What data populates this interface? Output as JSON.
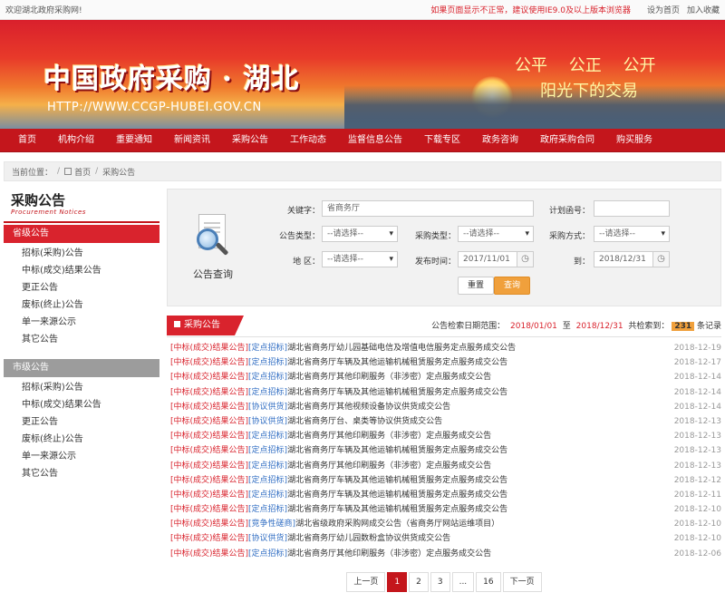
{
  "topbar": {
    "welcome": "欢迎湖北政府采购网!",
    "notice": "如果页面显示不正常，建议使用IE9.0及以上版本浏览器",
    "set_home": "设为首页",
    "bookmark": "加入收藏"
  },
  "banner": {
    "title": "中国政府采购 · 湖北",
    "url": "HTTP://WWW.CCGP-HUBEI.GOV.CN",
    "slogan_line1": "公平 公正 公开",
    "slogan_line2": "阳光下的交易"
  },
  "nav": [
    "首页",
    "机构介绍",
    "重要通知",
    "新闻资讯",
    "采购公告",
    "工作动态",
    "监督信息公告",
    "下载专区",
    "政务咨询",
    "政府采购合同",
    "购买服务"
  ],
  "breadcrumb": {
    "label": "当前位置：",
    "home": "首页",
    "sep": "/",
    "current": "采购公告"
  },
  "sidebar": {
    "title_cn": "采购公告",
    "title_en": "Procurement Notices",
    "groups": [
      {
        "title": "省级公告",
        "items": [
          "招标(采购)公告",
          "中标(成交)结果公告",
          "更正公告",
          "废标(终止)公告",
          "单一来源公示",
          "其它公告"
        ]
      },
      {
        "title": "市级公告",
        "items": [
          "招标(采购)公告",
          "中标(成交)结果公告",
          "更正公告",
          "废标(终止)公告",
          "单一来源公示",
          "其它公告"
        ]
      }
    ]
  },
  "search": {
    "caption": "公告查询",
    "keyword_label": "关键字：",
    "keyword_value": "省商务厅",
    "plan_no_label": "计划函号：",
    "plan_no_value": "",
    "notice_type_label": "公告类型：",
    "notice_type_value": "--请选择--",
    "purchase_type_label": "采购类型：",
    "purchase_type_value": "--请选择--",
    "purchase_method_label": "采购方式：",
    "purchase_method_value": "--请选择--",
    "area_label": "地 区：",
    "area_value": "--请选择--",
    "publish_label": "发布时间：",
    "date_from": "2017/11/01",
    "to_label": "到：",
    "date_to": "2018/12/31",
    "reset": "重置",
    "query": "查询"
  },
  "list_head": {
    "tab": "采购公告",
    "range_label": "公告检索日期范围：",
    "range_from": "2018/01/01",
    "range_to_word": "至",
    "range_to": "2018/12/31",
    "found_label": "共检索到：",
    "count": "231",
    "count_unit": "条记录"
  },
  "notices": [
    {
      "k1": "[中标(成交)结果公告]",
      "k2": "[定点招标]",
      "title": "湖北省商务厅幼儿园基础电信及增值电信服务定点服务成交公告",
      "date": "2018-12-19"
    },
    {
      "k1": "[中标(成交)结果公告]",
      "k2": "[定点招标]",
      "title": "湖北省商务厅车辆及其他运输机械租赁服务定点服务成交公告",
      "date": "2018-12-17"
    },
    {
      "k1": "[中标(成交)结果公告]",
      "k2": "[定点招标]",
      "title": "湖北省商务厅其他印刷服务（非涉密）定点服务成交公告",
      "date": "2018-12-14"
    },
    {
      "k1": "[中标(成交)结果公告]",
      "k2": "[定点招标]",
      "title": "湖北省商务厅车辆及其他运输机械租赁服务定点服务成交公告",
      "date": "2018-12-14"
    },
    {
      "k1": "[中标(成交)结果公告]",
      "k2": "[协议供货]",
      "title": "湖北省商务厅其他视频设备协议供货成交公告",
      "date": "2018-12-14"
    },
    {
      "k1": "[中标(成交)结果公告]",
      "k2": "[协议供货]",
      "title": "湖北省商务厅台、桌类等协议供货成交公告",
      "date": "2018-12-13"
    },
    {
      "k1": "[中标(成交)结果公告]",
      "k2": "[定点招标]",
      "title": "湖北省商务厅其他印刷服务（非涉密）定点服务成交公告",
      "date": "2018-12-13"
    },
    {
      "k1": "[中标(成交)结果公告]",
      "k2": "[定点招标]",
      "title": "湖北省商务厅车辆及其他运输机械租赁服务定点服务成交公告",
      "date": "2018-12-13"
    },
    {
      "k1": "[中标(成交)结果公告]",
      "k2": "[定点招标]",
      "title": "湖北省商务厅其他印刷服务（非涉密）定点服务成交公告",
      "date": "2018-12-13"
    },
    {
      "k1": "[中标(成交)结果公告]",
      "k2": "[定点招标]",
      "title": "湖北省商务厅车辆及其他运输机械租赁服务定点服务成交公告",
      "date": "2018-12-12"
    },
    {
      "k1": "[中标(成交)结果公告]",
      "k2": "[定点招标]",
      "title": "湖北省商务厅车辆及其他运输机械租赁服务定点服务成交公告",
      "date": "2018-12-11"
    },
    {
      "k1": "[中标(成交)结果公告]",
      "k2": "[定点招标]",
      "title": "湖北省商务厅车辆及其他运输机械租赁服务定点服务成交公告",
      "date": "2018-12-10"
    },
    {
      "k1": "[中标(成交)结果公告]",
      "k2": "[竞争性磋商]",
      "title": "湖北省级政府采购网成交公告（省商务厅网站运维项目）",
      "date": "2018-12-10"
    },
    {
      "k1": "[中标(成交)结果公告]",
      "k2": "[协议供货]",
      "title": "湖北省商务厅幼儿园数粉盒协议供货成交公告",
      "date": "2018-12-10"
    },
    {
      "k1": "[中标(成交)结果公告]",
      "k2": "[定点招标]",
      "title": "湖北省商务厅其他印刷服务（非涉密）定点服务成交公告",
      "date": "2018-12-06"
    }
  ],
  "pager": {
    "prev": "上一页",
    "pages": [
      "1",
      "2",
      "3",
      "...",
      "16"
    ],
    "next": "下一页",
    "current": "1"
  },
  "colors": {
    "brand_red": "#c4161c",
    "accent_orange": "#f0a03c",
    "link_blue": "#3470c4"
  }
}
